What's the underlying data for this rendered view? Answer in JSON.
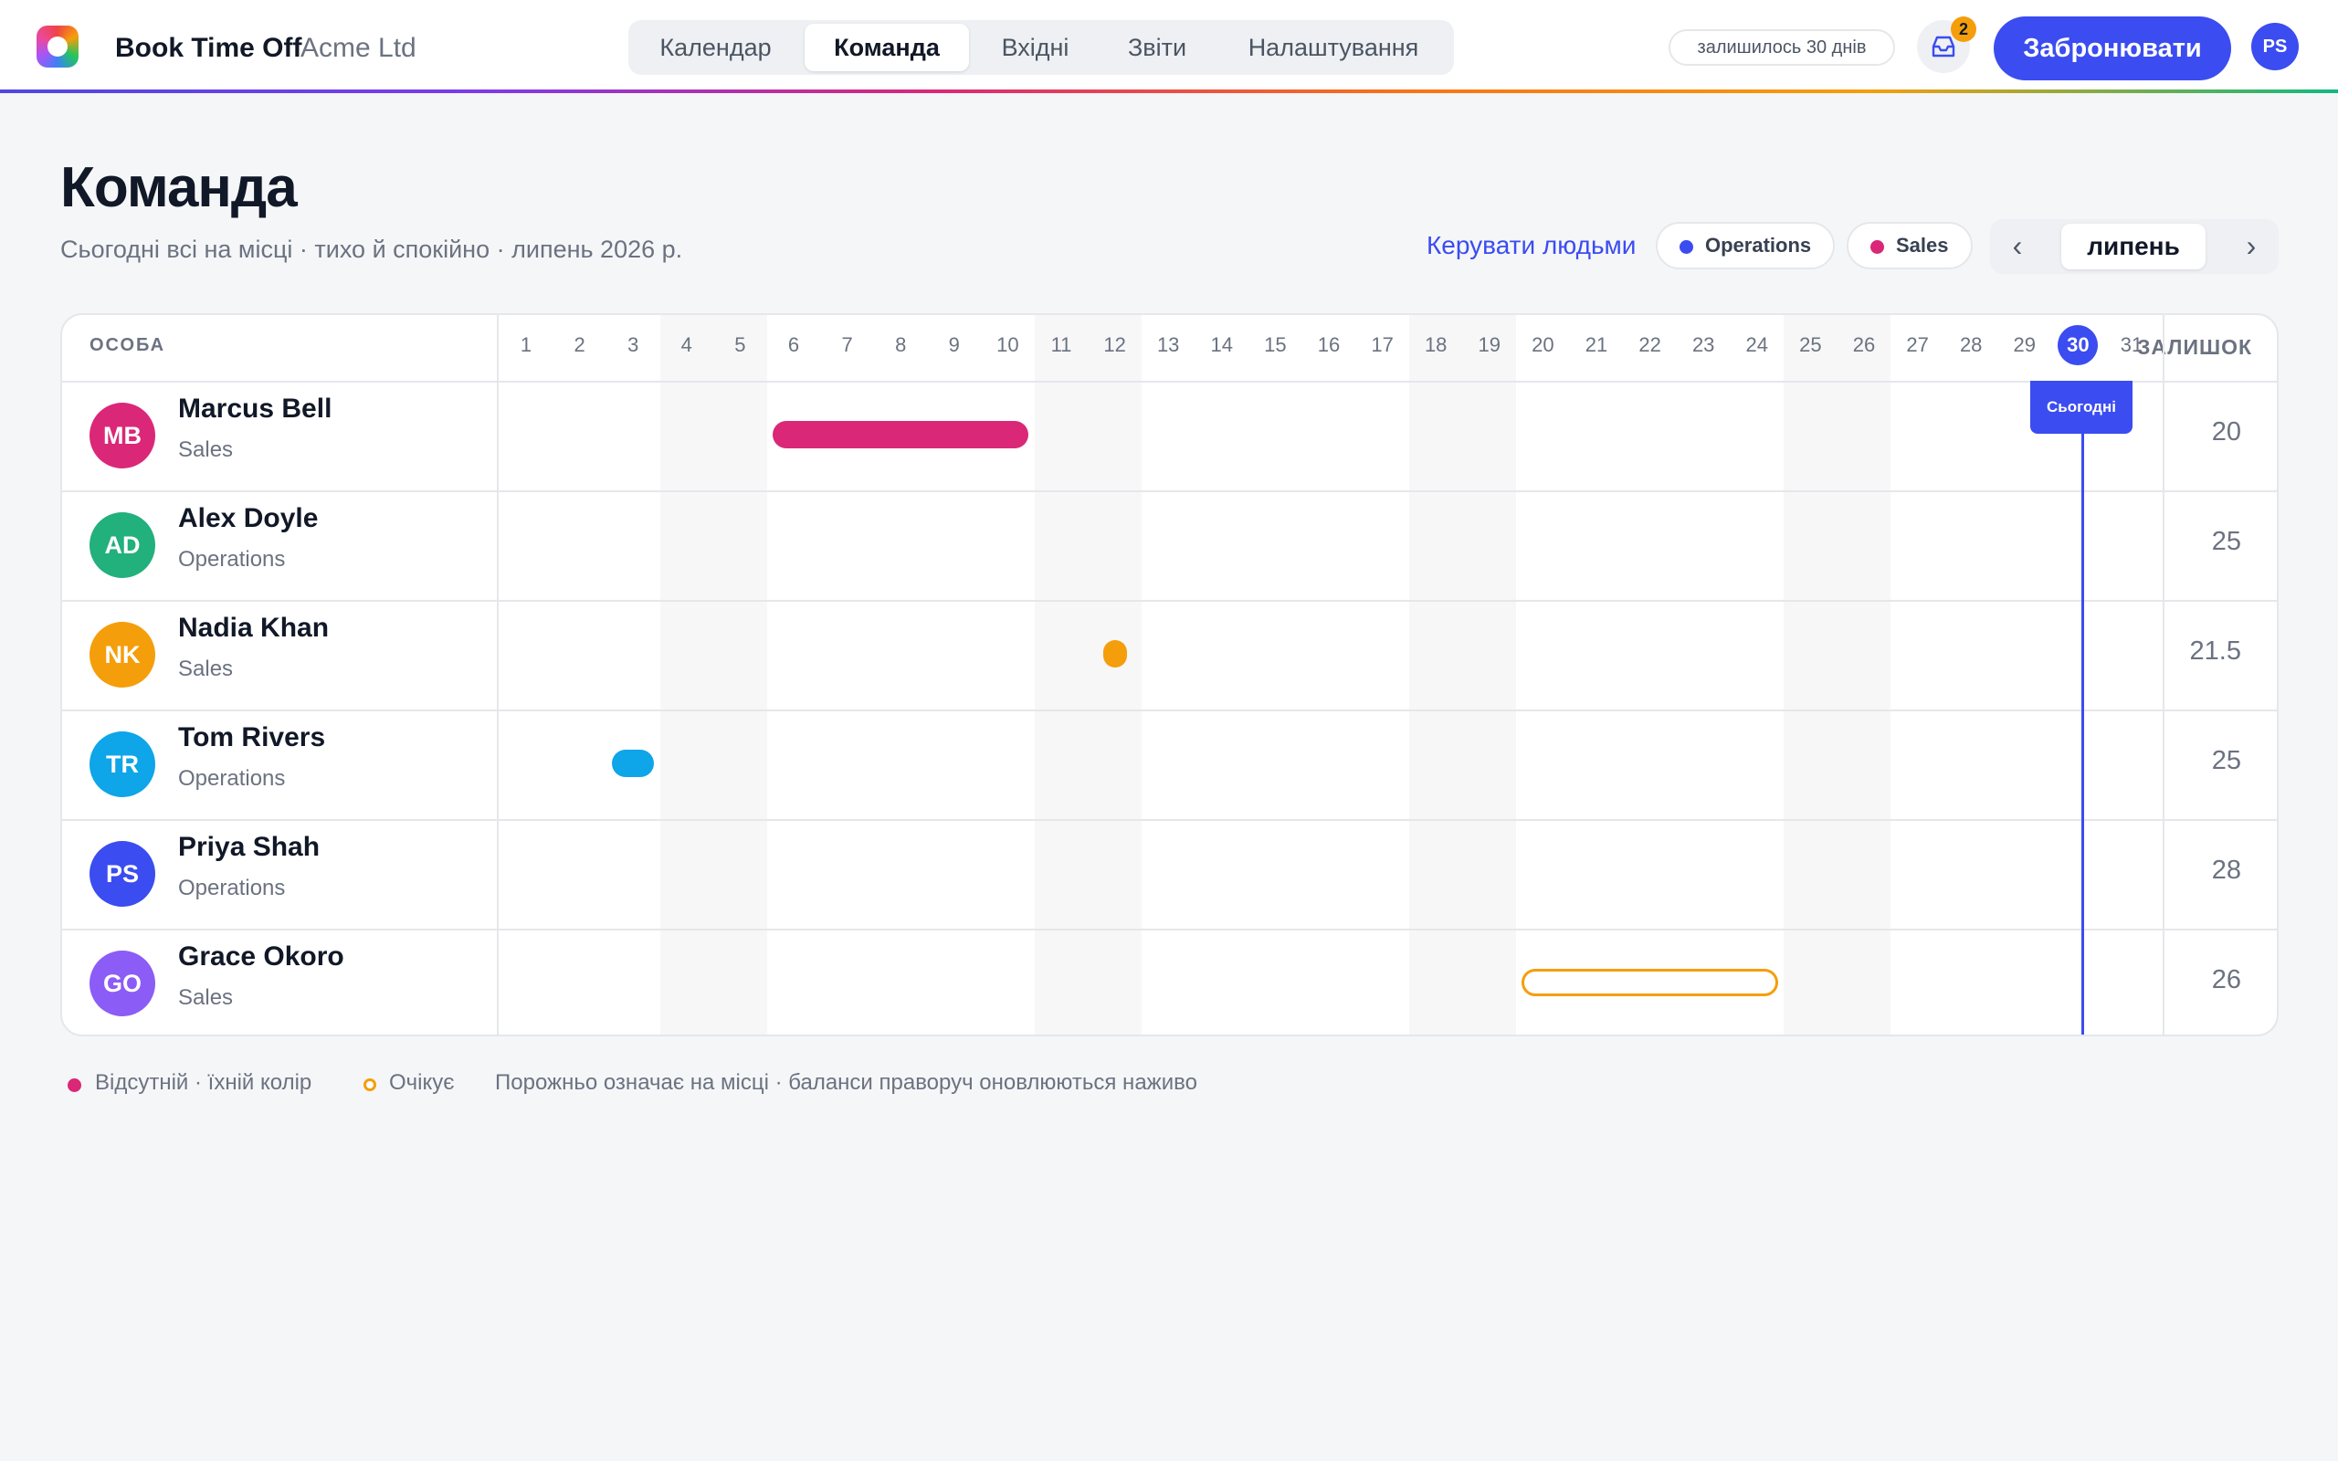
{
  "app": {
    "name": "Book Time Off",
    "org": "Acme Ltd"
  },
  "nav": {
    "tabs": [
      {
        "label": "Календар",
        "active": false
      },
      {
        "label": "Команда",
        "active": true
      },
      {
        "label": "Вхідні",
        "active": false
      },
      {
        "label": "Звіти",
        "active": false
      },
      {
        "label": "Налаштування",
        "active": false
      }
    ]
  },
  "header": {
    "days_left": "залишилось 30 днів",
    "inbox_icon": "inbox-icon",
    "inbox_count": "2",
    "book_label": "Забронювати",
    "user_initials": "PS"
  },
  "page": {
    "title": "Команда",
    "subtitle": "Сьогодні всі на місці · тихо й спокійно · липень 2026 р.",
    "manage_link": "Керувати людьми",
    "filters": [
      {
        "label": "Operations",
        "color": "#3b4cf0"
      },
      {
        "label": "Sales",
        "color": "#db2777"
      }
    ],
    "month": "липень",
    "prev_icon": "‹",
    "next_icon": "›"
  },
  "grid": {
    "col_person": "ОСОБА",
    "col_balance": "ЗАЛИШОК",
    "days": [
      1,
      2,
      3,
      4,
      5,
      6,
      7,
      8,
      9,
      10,
      11,
      12,
      13,
      14,
      15,
      16,
      17,
      18,
      19,
      20,
      21,
      22,
      23,
      24,
      25,
      26,
      27,
      28,
      29,
      30,
      31
    ],
    "weekend_days": [
      4,
      5,
      11,
      12,
      18,
      19,
      25,
      26
    ],
    "today": 30,
    "today_label": "Сьогодні",
    "people": [
      {
        "initials": "MB",
        "name": "Marcus Bell",
        "dept": "Sales",
        "balance": "20",
        "color": "#db2777",
        "absences": [
          {
            "from": 6,
            "to": 10,
            "status": "approved"
          }
        ]
      },
      {
        "initials": "AD",
        "name": "Alex Doyle",
        "dept": "Operations",
        "balance": "25",
        "color": "#22b07d",
        "absences": []
      },
      {
        "initials": "NK",
        "name": "Nadia Khan",
        "dept": "Sales",
        "balance": "21.5",
        "color": "#f59e0b",
        "absences": [
          {
            "from": 12,
            "to": 12,
            "status": "approved",
            "half": true
          }
        ]
      },
      {
        "initials": "TR",
        "name": "Tom Rivers",
        "dept": "Operations",
        "balance": "25",
        "color": "#0ea5e9",
        "absences": [
          {
            "from": 3,
            "to": 3,
            "status": "approved"
          }
        ]
      },
      {
        "initials": "PS",
        "name": "Priya Shah",
        "dept": "Operations",
        "balance": "28",
        "color": "#3b4cf0",
        "absences": []
      },
      {
        "initials": "GO",
        "name": "Grace Okoro",
        "dept": "Sales",
        "balance": "26",
        "color": "#8b5cf6",
        "absences": [
          {
            "from": 20,
            "to": 24,
            "status": "pending",
            "status_color": "#f59e0b"
          }
        ]
      }
    ]
  },
  "legend": {
    "absent": "Відсутній · їхній колір",
    "absent_color": "#db2777",
    "pending": "Очікує",
    "pending_color": "#f59e0b",
    "note": "Порожньо означає на місці · баланси праворуч оновлюються наживо"
  }
}
